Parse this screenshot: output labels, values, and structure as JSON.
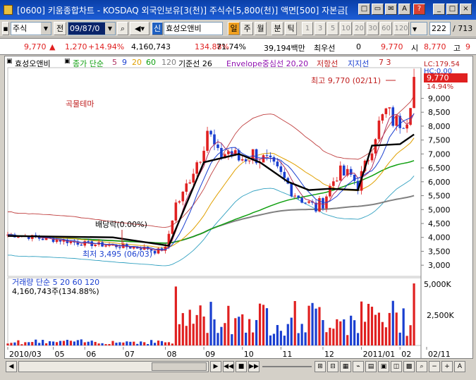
{
  "window": {
    "title": "[0600] 키움종합차트 - KOSDAQ 외국인보유[3(천)] 주식수[5,800(천)] 액면[500] 자본금[",
    "buttons": [
      "□",
      "▭",
      "✉",
      "A",
      "?",
      "_",
      "□",
      "×"
    ]
  },
  "toolbar": {
    "type_select": "주식",
    "prev_label": "전",
    "date_value": "09/87/0",
    "search_icon": "search-icon",
    "sound_icon": "speaker-icon",
    "new_label": "신",
    "stock_name": "효성오앤비",
    "period_labels": [
      "일",
      "주",
      "월",
      "분",
      "틱"
    ],
    "interval_labels": [
      "1",
      "3",
      "5",
      "10",
      "20",
      "30",
      "60",
      "120"
    ],
    "count_value": "222",
    "count_total": "/ 713"
  },
  "infobar": {
    "price": "9,770",
    "change": "1,270",
    "change_pct": "+14.94%",
    "volume": "4,160,743",
    "volume_pct": "134.88%",
    "ratio": "71.74%",
    "amount": "39,194백만",
    "label_priority": "최우선",
    "priority_value": "0",
    "ask": "9,770",
    "open_label": "시",
    "open_value": "8,770",
    "high_label": "고",
    "high_value": "9"
  },
  "legend": {
    "name": "효성오앤비",
    "ma_label": "종가 단순",
    "ma_periods": [
      "5",
      "9",
      "20",
      "60",
      "120"
    ],
    "base_label": "기준선 26",
    "envelope": "Envelope중심선 20,20",
    "resist": "저항선",
    "support": "지지선",
    "rs_values": "7 3"
  },
  "annotations": {
    "theme": "곡물테마",
    "dividend": "배당락(0.00%)",
    "low": "최저 3,495 (06/03)",
    "high": "최고 9,770 (02/11)",
    "lc": "LC:179.54",
    "hc": "HC:0.00",
    "last_price": "9,770",
    "last_pct": "14.94%"
  },
  "chart_data": {
    "type": "candlestick",
    "price_axis": [
      "9,000",
      "8,500",
      "8,000",
      "7,500",
      "7,000",
      "6,500",
      "6,000",
      "5,500",
      "5,000",
      "4,500",
      "4,000",
      "3,500",
      "3,000"
    ],
    "ylim": [
      2700,
      10000
    ],
    "date_axis": [
      "2010/03",
      "05",
      "06",
      "07",
      "08",
      "09",
      "10",
      "11",
      "12",
      "2011/01",
      "02",
      "02/11"
    ],
    "close_series": [
      [
        0,
        4100
      ],
      [
        5,
        4050
      ],
      [
        10,
        3950
      ],
      [
        15,
        3900
      ],
      [
        20,
        3800
      ],
      [
        25,
        3750
      ],
      [
        30,
        3700
      ],
      [
        35,
        3650
      ],
      [
        40,
        3600
      ],
      [
        42,
        3495
      ],
      [
        45,
        3600
      ],
      [
        48,
        5200
      ],
      [
        50,
        5500
      ],
      [
        52,
        6200
      ],
      [
        55,
        7000
      ],
      [
        57,
        7900
      ],
      [
        60,
        6900
      ],
      [
        63,
        7100
      ],
      [
        66,
        6800
      ],
      [
        70,
        7000
      ],
      [
        74,
        6700
      ],
      [
        78,
        6200
      ],
      [
        82,
        5600
      ],
      [
        86,
        5200
      ],
      [
        88,
        5050
      ],
      [
        90,
        5300
      ],
      [
        94,
        6300
      ],
      [
        98,
        6200
      ],
      [
        100,
        5900
      ],
      [
        102,
        6500
      ],
      [
        105,
        7800
      ],
      [
        108,
        8500
      ],
      [
        111,
        8100
      ],
      [
        114,
        8400
      ],
      [
        116,
        9770
      ]
    ],
    "volume_axis": [
      "5,000K",
      "2,500K"
    ],
    "volume_label": "거래량 단순 5 20 60 120",
    "volume_value": "4,160,743주(134.88%)"
  },
  "colors": {
    "up": "#e02020",
    "down": "#1a3fd0",
    "ma5": "#b03060",
    "ma20": "#e0a000",
    "ma60": "#10a010",
    "ma120": "#808080",
    "base": "#000000",
    "envelope": "#c04040",
    "envelope_low": "#30a0c0"
  }
}
